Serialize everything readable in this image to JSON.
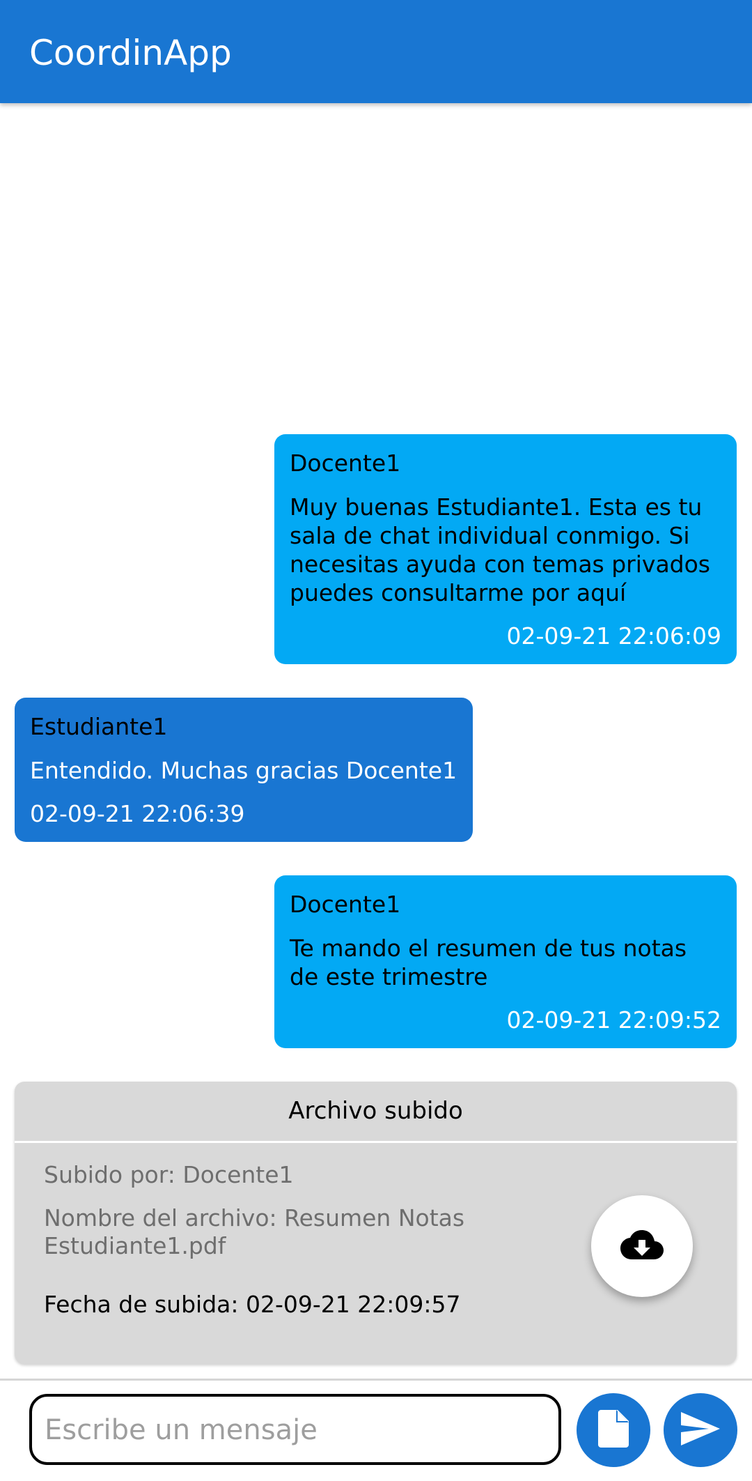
{
  "app": {
    "title": "CoordinApp"
  },
  "messages": [
    {
      "sender": "Docente1",
      "text": "Muy buenas Estudiante1. Esta es tu sala de chat individual conmigo. Si necesitas ayuda con temas privados puedes consultarme por aquí",
      "time": "02-09-21 22:06:09"
    },
    {
      "sender": "Estudiante1",
      "text": "Entendido. Muchas gracias Docente1",
      "time": "02-09-21 22:06:39"
    },
    {
      "sender": "Docente1",
      "text": "Te mando el resumen de tus notas de este trimestre",
      "time": "02-09-21 22:09:52"
    }
  ],
  "file": {
    "header": "Archivo subido",
    "uploaded_by": "Subido por: Docente1",
    "file_name": "Nombre del archivo: Resumen Notas Estudiante1.pdf",
    "upload_date": "Fecha de subida: 02-09-21 22:09:57",
    "download_icon": "cloud-download-icon"
  },
  "composer": {
    "placeholder": "Escribe un mensaje",
    "value": "",
    "attach_icon": "file-icon",
    "send_icon": "send-icon"
  },
  "colors": {
    "primary": "#1976d2",
    "outgoing_bubble": "#03a9f4",
    "incoming_bubble": "#1976d2",
    "file_card": "#d9d9d9"
  }
}
